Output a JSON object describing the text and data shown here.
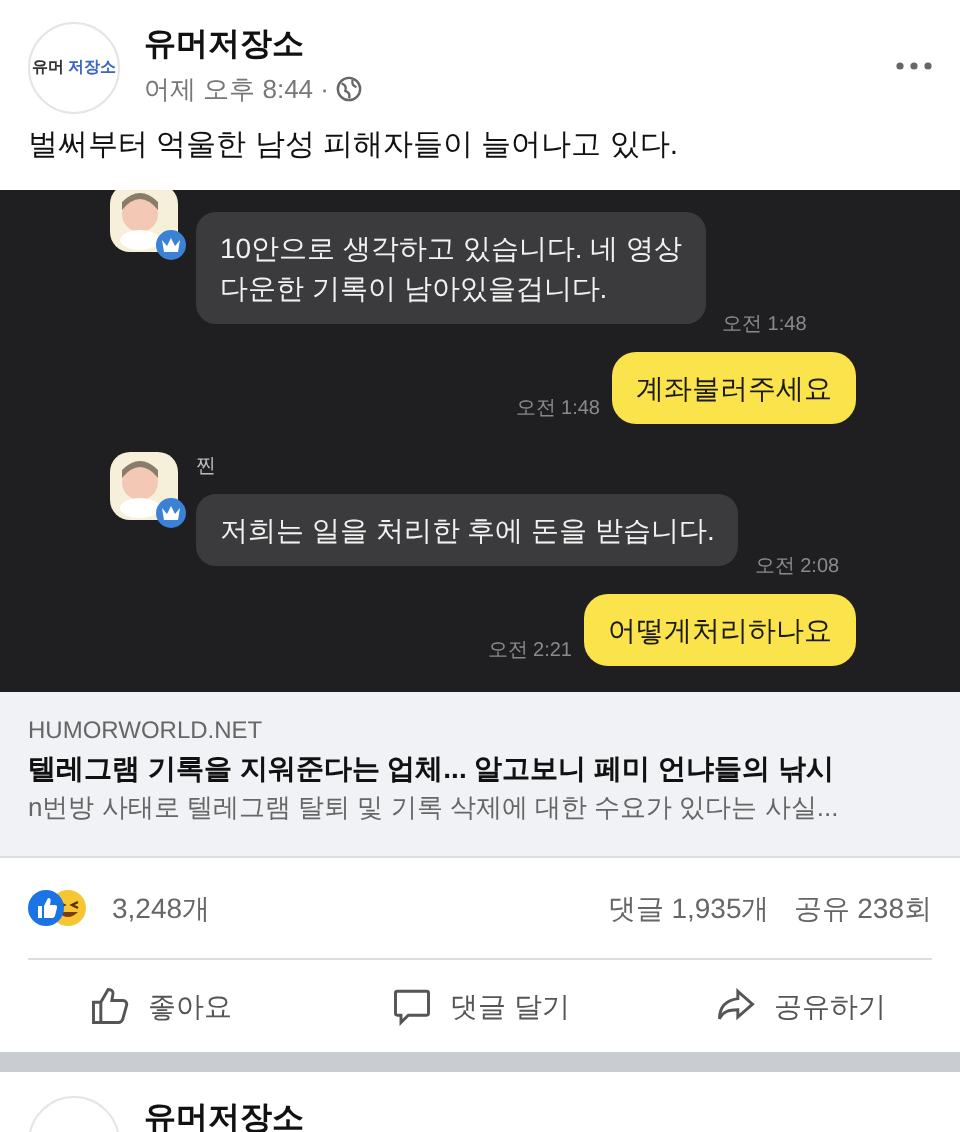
{
  "post": {
    "page_name": "유머저장소",
    "avatar_text_1": "유머",
    "avatar_text_2": "저장소",
    "time": "어제 오후 8:44 ·",
    "text": "벌써부터 억울한 남성 피해자들이 늘어나고 있다.",
    "chat": [
      {
        "kind": "received",
        "lines": [
          "10안으로 생각하고 있습니다. 네 영상",
          "다운한 기록이 남아있을겁니다."
        ],
        "time": "오전 1:48"
      },
      {
        "kind": "sent",
        "lines": [
          "계좌불러주세요"
        ],
        "time": "오전 1:48"
      },
      {
        "kind": "received",
        "sender": "찐",
        "lines": [
          "저희는 일을 처리한 후에 돈을 받습니다."
        ],
        "time": "오전 2:08"
      },
      {
        "kind": "sent",
        "lines": [
          "어떻게처리하나요"
        ],
        "time": "오전 2:21"
      }
    ],
    "link": {
      "domain": "HUMORWORLD.NET",
      "title": "텔레그램 기록을 지워준다는 업체... 알고보니 페미 언냐들의 낚시",
      "description": "n번방 사태로 텔레그램 탈퇴 및 기록 삭제에 대한 수요가 있다는 사실..."
    },
    "reactions": "3,248개",
    "comments": "댓글 1,935개",
    "shares": "공유 238회",
    "actions": [
      {
        "kind": "like",
        "label": "좋아요"
      },
      {
        "kind": "comment",
        "label": "댓글 달기"
      },
      {
        "kind": "share",
        "label": "공유하기"
      }
    ]
  },
  "next_post": {
    "page_name": "유머저장소"
  }
}
